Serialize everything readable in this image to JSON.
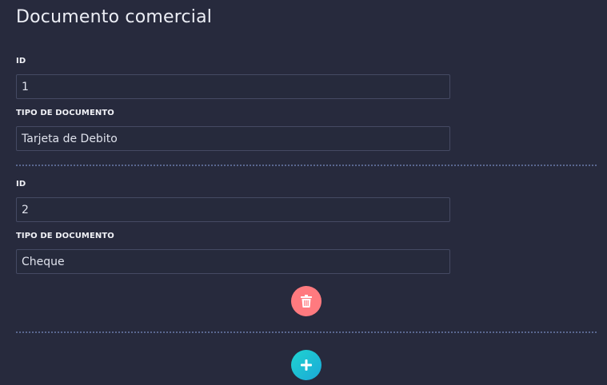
{
  "page": {
    "title": "Documento comercial"
  },
  "records": [
    {
      "id_label": "ID",
      "id_value": "1",
      "type_label": "TIPO DE DOCUMENTO",
      "type_value": "Tarjeta de Debito"
    },
    {
      "id_label": "ID",
      "id_value": "2",
      "type_label": "TIPO DE DOCUMENTO",
      "type_value": "Cheque"
    }
  ],
  "actions": {
    "delete_icon": "trash-icon",
    "add_icon": "plus-icon"
  },
  "colors": {
    "background": "#272a3d",
    "input_border": "#454a63",
    "delete_button": "#ff7a7f",
    "add_button_start": "#1fd3d0",
    "add_button_end": "#1ba9d8",
    "divider": "#5a6790"
  }
}
